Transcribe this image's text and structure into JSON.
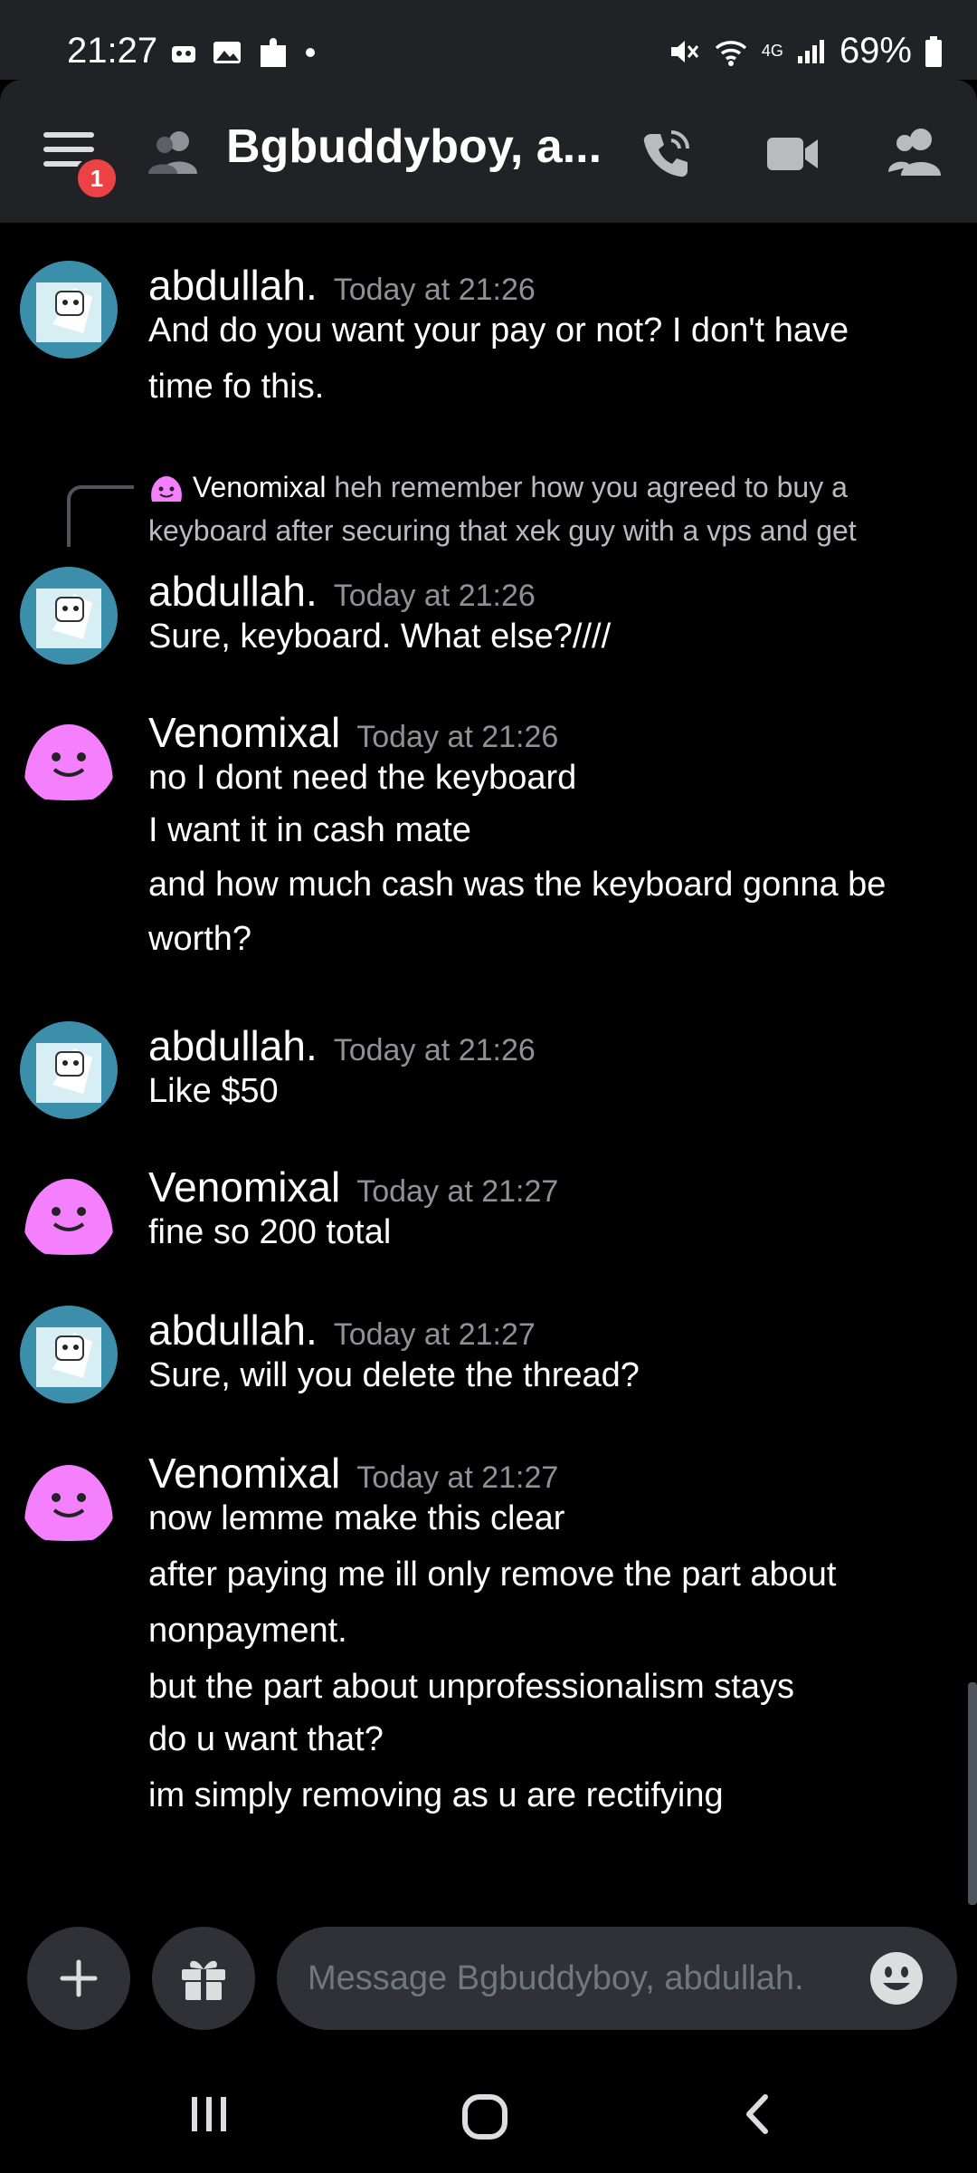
{
  "status_bar": {
    "time": "21:27",
    "network": "4G",
    "battery": "69%"
  },
  "header": {
    "title": "Bgbuddyboy, a...",
    "notification_count": "1"
  },
  "reply_preview": {
    "author": "Venomixal",
    "text_line1": "heh remember how you agreed to buy a",
    "text_line2": "keyboard after securing that xek guy with a vps and get"
  },
  "messages": [
    {
      "author": "abdullah.",
      "timestamp": "Today at 21:26",
      "lines": [
        "And do you want your pay or not? I don't have",
        "time fo this."
      ]
    },
    {
      "author": "abdullah.",
      "timestamp": "Today at 21:26",
      "lines": [
        "Sure, keyboard. What else?////"
      ]
    },
    {
      "author": "Venomixal",
      "timestamp": "Today at 21:26",
      "lines": [
        "no I dont need the keyboard",
        "I want it in cash mate",
        "and how much cash was the keyboard gonna be",
        "worth?"
      ]
    },
    {
      "author": "abdullah.",
      "timestamp": "Today at 21:26",
      "lines": [
        "Like $50"
      ]
    },
    {
      "author": "Venomixal",
      "timestamp": "Today at 21:27",
      "lines": [
        "fine so 200 total"
      ]
    },
    {
      "author": "abdullah.",
      "timestamp": "Today at 21:27",
      "lines": [
        "Sure, will you delete the thread?"
      ]
    },
    {
      "author": "Venomixal",
      "timestamp": "Today at 21:27",
      "lines": [
        "now lemme make this clear",
        "after paying me ill only remove the part about",
        "nonpayment.",
        "but the part about unprofessionalism stays",
        "do u want that?",
        "im simply removing as u are rectifying"
      ]
    }
  ],
  "composer": {
    "placeholder": "Message Bgbuddyboy, abdullah."
  },
  "colors": {
    "background": "#000000",
    "header": "#202225",
    "badge": "#ed4245",
    "venom_avatar": "#f47fff",
    "abdullah_avatar": "#2c6b85"
  }
}
